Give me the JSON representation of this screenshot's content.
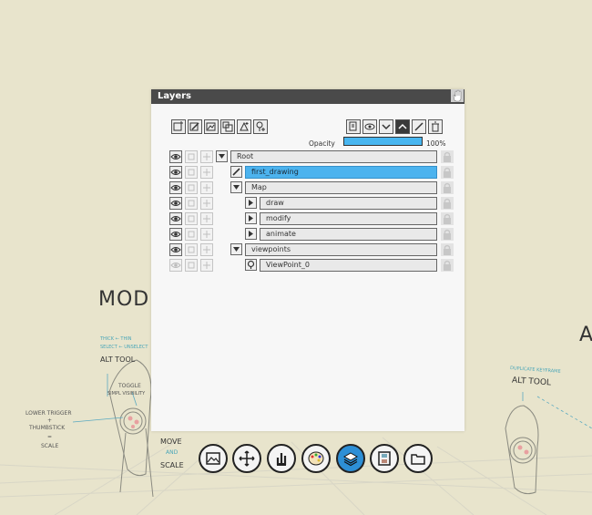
{
  "panel": {
    "title": "Layers",
    "opacity_label": "Opacity",
    "opacity_value": "100%",
    "opacity_fraction": 1.0
  },
  "toolbar_left": [
    {
      "name": "new-layer-icon"
    },
    {
      "name": "new-drawing-icon"
    },
    {
      "name": "new-group-icon"
    },
    {
      "name": "duplicate-icon"
    },
    {
      "name": "add-light-icon"
    },
    {
      "name": "add-viewpoint-icon"
    }
  ],
  "toolbar_right": [
    {
      "name": "copy-layer-icon"
    },
    {
      "name": "visibility-icon"
    },
    {
      "name": "move-down-icon"
    },
    {
      "name": "move-up-icon",
      "active": true
    },
    {
      "name": "rename-icon"
    },
    {
      "name": "delete-icon"
    }
  ],
  "layers": [
    {
      "name": "Root",
      "depth": 0,
      "expander": "down",
      "visible": true
    },
    {
      "name": "first_drawing",
      "depth": 1,
      "expander": "pen",
      "visible": true,
      "selected": true
    },
    {
      "name": "Map",
      "depth": 1,
      "expander": "down",
      "visible": true
    },
    {
      "name": "draw",
      "depth": 2,
      "expander": "right",
      "visible": true
    },
    {
      "name": "modify",
      "depth": 2,
      "expander": "right",
      "visible": true
    },
    {
      "name": "animate",
      "depth": 2,
      "expander": "right",
      "visible": true
    },
    {
      "name": "viewpoints",
      "depth": 1,
      "expander": "down",
      "visible": true
    },
    {
      "name": "ViewPoint_0",
      "depth": 2,
      "expander": "pin",
      "visible": false
    }
  ],
  "dock": [
    {
      "name": "gallery-icon"
    },
    {
      "name": "move-icon"
    },
    {
      "name": "brushes-icon"
    },
    {
      "name": "palette-icon"
    },
    {
      "name": "layers-icon",
      "active": true
    },
    {
      "name": "film-icon"
    },
    {
      "name": "folder-icon"
    }
  ],
  "background": {
    "mode_left": "MOD",
    "mode_right": "A",
    "tool_left": "ALT TOOL",
    "tool_right": "ALT TOOL",
    "move_text": [
      "MOVE",
      "AND",
      "SCALE"
    ],
    "toggle_text": [
      "TOGGLE",
      "SIMPL VISIBILITY"
    ],
    "left_hint": [
      "LOWER TRIGGER",
      "+",
      "THUMBSTICK",
      "=",
      "SCALE"
    ],
    "teal_left": [
      "THICK ← THIN",
      "SELECT ← UNSELECT"
    ],
    "teal_right": "DUPLICATE KEYFRAME"
  },
  "colors": {
    "selected": "#4cb3ee",
    "opacity_bar": "#48b6f0",
    "active_dock": "#2d8fd6",
    "titlebar": "#4a4a4a"
  }
}
